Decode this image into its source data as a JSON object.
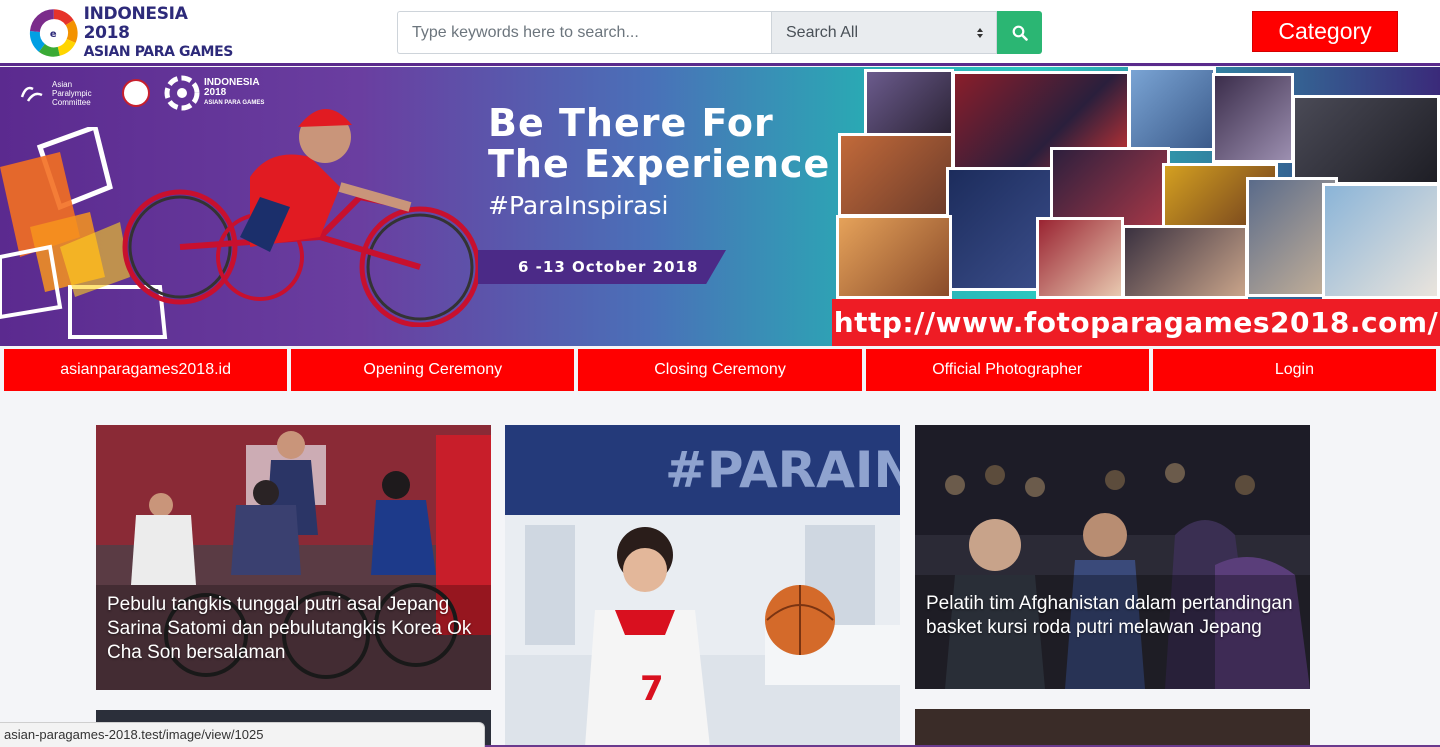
{
  "header": {
    "logo": {
      "line1": "INDONESIA 2018",
      "line2": "ASIAN PARA GAMES"
    },
    "search": {
      "placeholder": "Type keywords here to search...",
      "value": ""
    },
    "search_scope": {
      "selected": "Search All"
    },
    "search_button_icon": "search-icon",
    "category_label": "Category"
  },
  "banner": {
    "partners": {
      "apc": "Asian Paralympic Committee",
      "event_logo_year": "INDONESIA 2018",
      "event_logo_sub": "ASIAN PARA GAMES"
    },
    "headline_line1": "Be There For",
    "headline_line2": "The Experience",
    "hashtag": "#ParaInspirasi",
    "dates": "6 -13 October 2018",
    "url": "http://www.fotoparagames2018.com/"
  },
  "nav": [
    {
      "label": "asianparagames2018.id"
    },
    {
      "label": "Opening Ceremony"
    },
    {
      "label": "Closing Ceremony"
    },
    {
      "label": "Official Photographer"
    },
    {
      "label": "Login"
    }
  ],
  "cards": [
    {
      "caption": "Pebulu tangkis tunggal putri asal Jepang Sarina Satomi dan pebulutangkis Korea Ok Cha Son bersalaman"
    },
    {
      "caption": "",
      "sign_text": "#PARAIN",
      "jersey": "7"
    },
    {
      "caption": "Pelatih tim Afghanistan dalam pertandingan basket kursi roda putri melawan Jepang"
    }
  ],
  "status_bar": {
    "url": "asian-paragames-2018.test/image/view/1025"
  },
  "colors": {
    "accent_red": "#ff0000",
    "search_green": "#2bb673",
    "brand_purple": "#5b2a8f"
  }
}
